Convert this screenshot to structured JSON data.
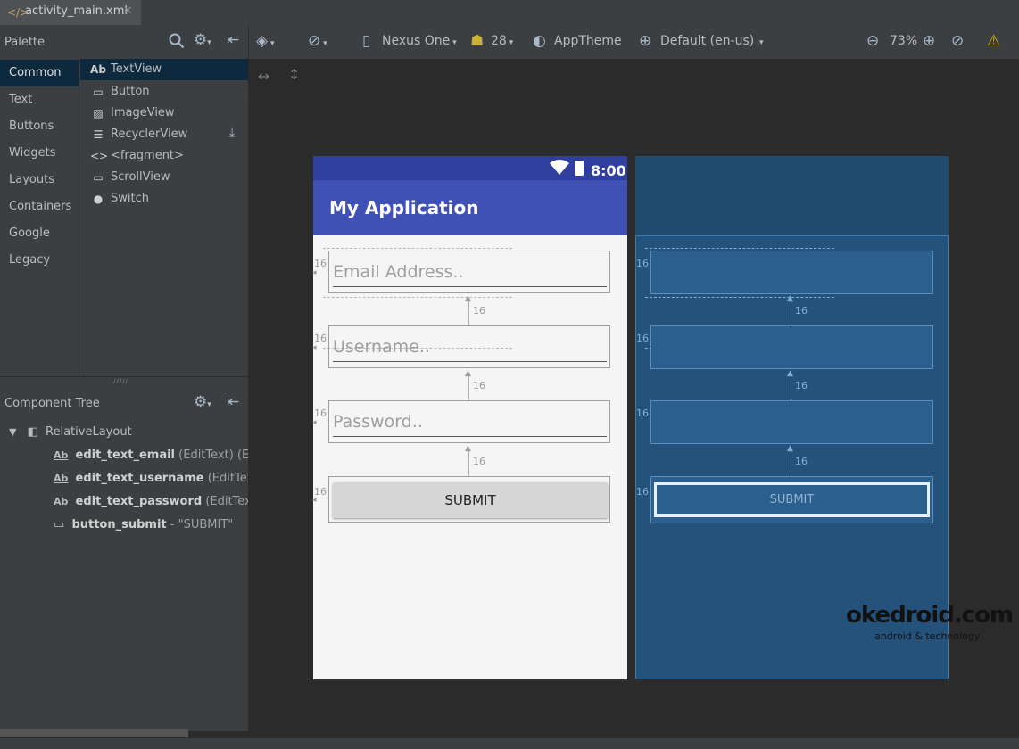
{
  "tab": {
    "file_name": "activity_main.xml",
    "close": "✕"
  },
  "palette": {
    "title": "Palette",
    "categories": [
      "Common",
      "Text",
      "Buttons",
      "Widgets",
      "Layouts",
      "Containers",
      "Google",
      "Legacy"
    ],
    "selected_category": "Common",
    "items": [
      {
        "icon": "Ab",
        "label": "TextView"
      },
      {
        "icon": "▭",
        "label": "Button"
      },
      {
        "icon": "▨",
        "label": "ImageView"
      },
      {
        "icon": "☰",
        "label": "RecyclerView"
      },
      {
        "icon": "<>",
        "label": "<fragment>"
      },
      {
        "icon": "▭",
        "label": "ScrollView"
      },
      {
        "icon": "●",
        "label": "Switch"
      }
    ]
  },
  "component_tree": {
    "title": "Component Tree",
    "root": "RelativeLayout",
    "children": [
      {
        "icon": "Ab",
        "id": "edit_text_email",
        "detail": "(EditText) (E-m"
      },
      {
        "icon": "Ab",
        "id": "edit_text_username",
        "detail": "(EditText) ("
      },
      {
        "icon": "Ab",
        "id": "edit_text_password",
        "detail": "(EditText) ("
      },
      {
        "icon": "▭",
        "id": "button_submit",
        "detail": "- \"SUBMIT\""
      }
    ]
  },
  "toolbar": {
    "device": "Nexus One",
    "api": "28",
    "theme": "AppTheme",
    "locale": "Default (en-us)",
    "zoom": "73%"
  },
  "preview": {
    "status_time": "8:00",
    "app_title": "My Application",
    "email_hint": "Email Address..",
    "username_hint": "Username..",
    "password_hint": "Password..",
    "submit_label": "SUBMIT",
    "margin": "16"
  },
  "blueprint": {
    "submit_label": "SUBMIT",
    "margin": "16"
  },
  "watermark": {
    "name": "okedroid.com",
    "tagline": "android & technology"
  }
}
